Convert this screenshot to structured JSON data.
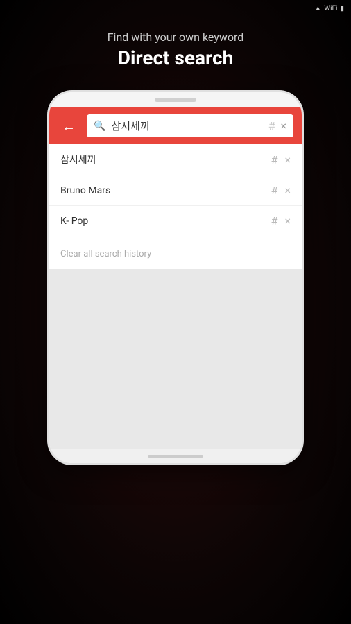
{
  "statusBar": {
    "icons": [
      "signal",
      "wifi",
      "battery"
    ]
  },
  "header": {
    "subtitle": "Find with your own keyword",
    "title": "Direct search"
  },
  "phone": {
    "searchBar": {
      "backLabel": "←",
      "searchIconLabel": "🔍",
      "inputValue": "삼시세끼",
      "hashLabel": "#",
      "clearLabel": "×"
    },
    "results": [
      {
        "text": "삼시세끼",
        "hash": "#",
        "close": "×"
      },
      {
        "text": "Bruno Mars",
        "hash": "#",
        "close": "×"
      },
      {
        "text": "K- Pop",
        "hash": "#",
        "close": "×"
      }
    ],
    "clearHistory": "Clear all search history"
  }
}
